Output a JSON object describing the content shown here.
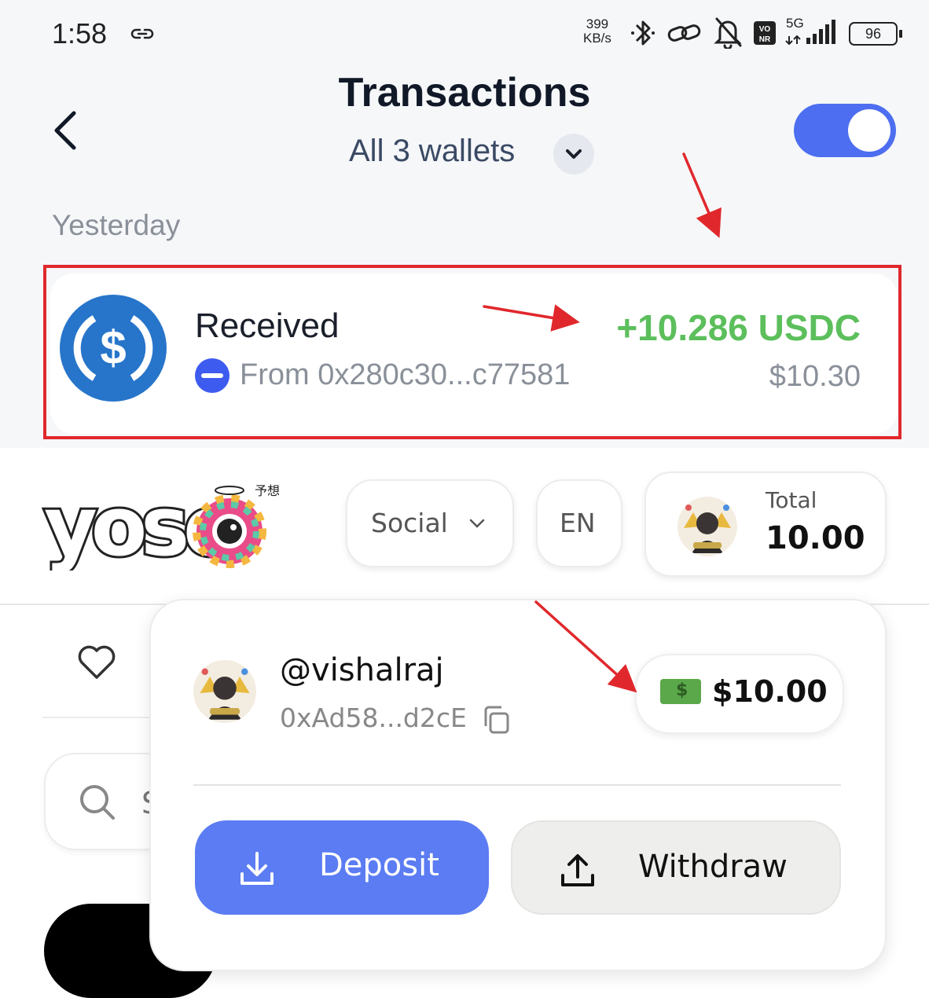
{
  "status_bar": {
    "time": "1:58",
    "net_speed_value": "399",
    "net_speed_unit": "KB/s",
    "network": "5G",
    "battery": "96",
    "icons": [
      "link-icon",
      "bluetooth-icon",
      "hotspot-icon",
      "mute-icon",
      "vonr-icon",
      "signal-icon",
      "battery-icon"
    ]
  },
  "header": {
    "title": "Transactions",
    "wallets_label": "All 3 wallets",
    "toggle_on": true
  },
  "section": {
    "label": "Yesterday"
  },
  "transaction": {
    "type": "Received",
    "from": "From 0x280c30...c77581",
    "amount": "+10.286 USDC",
    "fiat": "$10.30",
    "token_icon": "usdc-icon",
    "amount_color": "#5cbf5c"
  },
  "yoso": {
    "logo_text": "yoso",
    "logo_subtext": "予想",
    "social_label": "Social",
    "language": "EN",
    "total_label": "Total",
    "total_value": "10.00"
  },
  "popup": {
    "username": "@vishalraj",
    "address": "0xAd58...d2cE",
    "balance": "$10.00",
    "deposit_label": "Deposit",
    "withdraw_label": "Withdraw",
    "search_partial": "S"
  },
  "colors": {
    "accent": "#4d6ef0",
    "annotation_red": "#e0282c",
    "deposit_blue": "#5b7cf2"
  }
}
